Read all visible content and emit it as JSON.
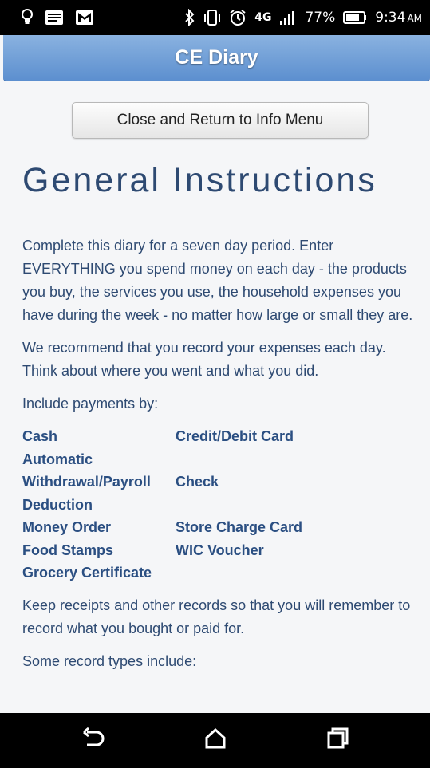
{
  "status_bar": {
    "battery": "77%",
    "time": "9:34",
    "ampm": "AM",
    "network": "4G"
  },
  "header": {
    "title": "CE Diary"
  },
  "close_button_label": "Close and Return to Info Menu",
  "page_title": "General Instructions",
  "paragraphs": [
    "Complete this diary for a seven day period. Enter EVERYTHING you spend money on each day - the products you buy, the services you use, the household expenses you have during the week - no matter how large or small they are.",
    "We recommend that you record your expenses each day. Think about where you went and what you did.",
    "Include payments by:"
  ],
  "payments": [
    "Cash",
    "Credit/Debit Card",
    "Automatic Withdrawal/Payroll Deduction",
    "Check",
    "Money Order",
    "Store Charge Card",
    "Food Stamps",
    "WIC Voucher",
    "Grocery Certificate",
    ""
  ],
  "paragraphs_after": [
    "Keep receipts and other records so that you will remember to record what you bought or paid for.",
    "Some record types include:"
  ],
  "icons": {
    "status": [
      "lightbulb-icon",
      "message-icon",
      "gmail-icon",
      "bluetooth-icon",
      "vibrate-icon",
      "alarm-icon",
      "signal-icon",
      "battery-icon"
    ],
    "nav": [
      "back-icon",
      "home-icon",
      "recents-icon"
    ]
  }
}
